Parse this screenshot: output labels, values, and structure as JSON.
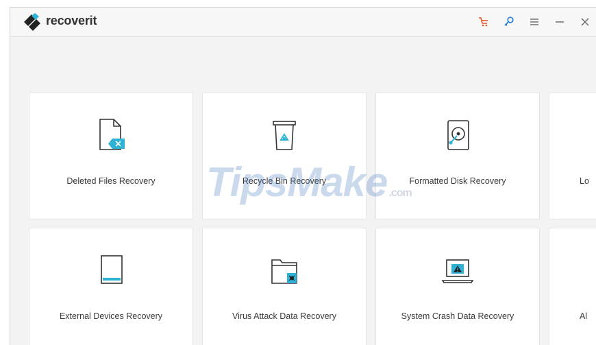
{
  "app": {
    "name": "recoverit",
    "accent": "#2eb2d6",
    "cart_color": "#e8542a"
  },
  "titlebar_buttons": [
    {
      "name": "cart-icon"
    },
    {
      "name": "key-icon"
    },
    {
      "name": "menu-icon"
    },
    {
      "name": "minimize-icon"
    },
    {
      "name": "close-icon"
    }
  ],
  "cards": [
    {
      "label": "Deleted Files Recovery",
      "icon": "deleted-file-icon"
    },
    {
      "label": "Recycle Bin Recovery",
      "icon": "recycle-bin-icon"
    },
    {
      "label": "Formatted Disk Recovery",
      "icon": "formatted-disk-icon"
    },
    {
      "label": "Lo",
      "icon": ""
    },
    {
      "label": "External Devices Recovery",
      "icon": "external-device-icon"
    },
    {
      "label": "Virus Attack Data Recovery",
      "icon": "virus-folder-icon"
    },
    {
      "label": "System Crash Data Recovery",
      "icon": "system-crash-icon"
    },
    {
      "label": "Al",
      "icon": ""
    }
  ],
  "watermark": {
    "text": "TipsMake",
    "suffix": ".com"
  }
}
